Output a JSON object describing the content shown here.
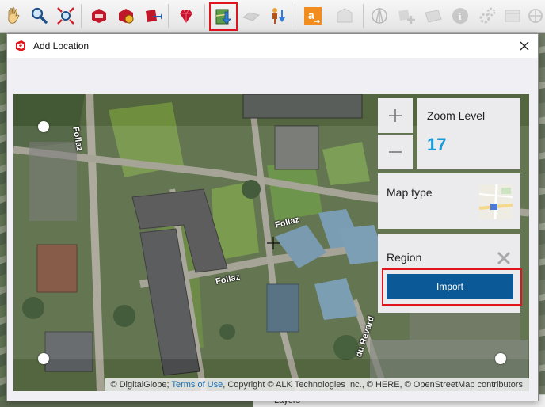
{
  "dialog": {
    "title": "Add Location",
    "colors": {
      "accent": "#1a9ad6",
      "primary_button": "#0b5a97",
      "highlight": "#e0141d"
    }
  },
  "map": {
    "street_labels": [
      "Follaz",
      "Follaz",
      "Follaz",
      "du Revard"
    ],
    "zoom": {
      "title": "Zoom Level",
      "value": "17"
    },
    "map_type": {
      "label": "Map type"
    },
    "region": {
      "label": "Region",
      "import_label": "Import"
    },
    "attribution": {
      "prefix": "© DigitalGlobe; ",
      "terms_link": "Terms of Use",
      "suffix": ", Copyright © ALK Technologies Inc., © HERE, © OpenStreetMap contributors"
    }
  },
  "background_app": {
    "toolbar_icons": [
      "hand-icon",
      "magnifier-icon",
      "zoom-extents-icon",
      "ruby-icon-1",
      "ruby-icon-2",
      "ruby-icon-3",
      "extension-warehouse-icon",
      "add-location-icon",
      "toggle-terrain-icon",
      "photo-texture-icon",
      "3d-warehouse-icon",
      "sandbox-icon",
      "compass-icon",
      "add-detail-icon",
      "grid-icon",
      "info-icon",
      "settings-icon",
      "panel-icon",
      "orbit-icon"
    ],
    "bottom_panel_text": "Layers"
  }
}
